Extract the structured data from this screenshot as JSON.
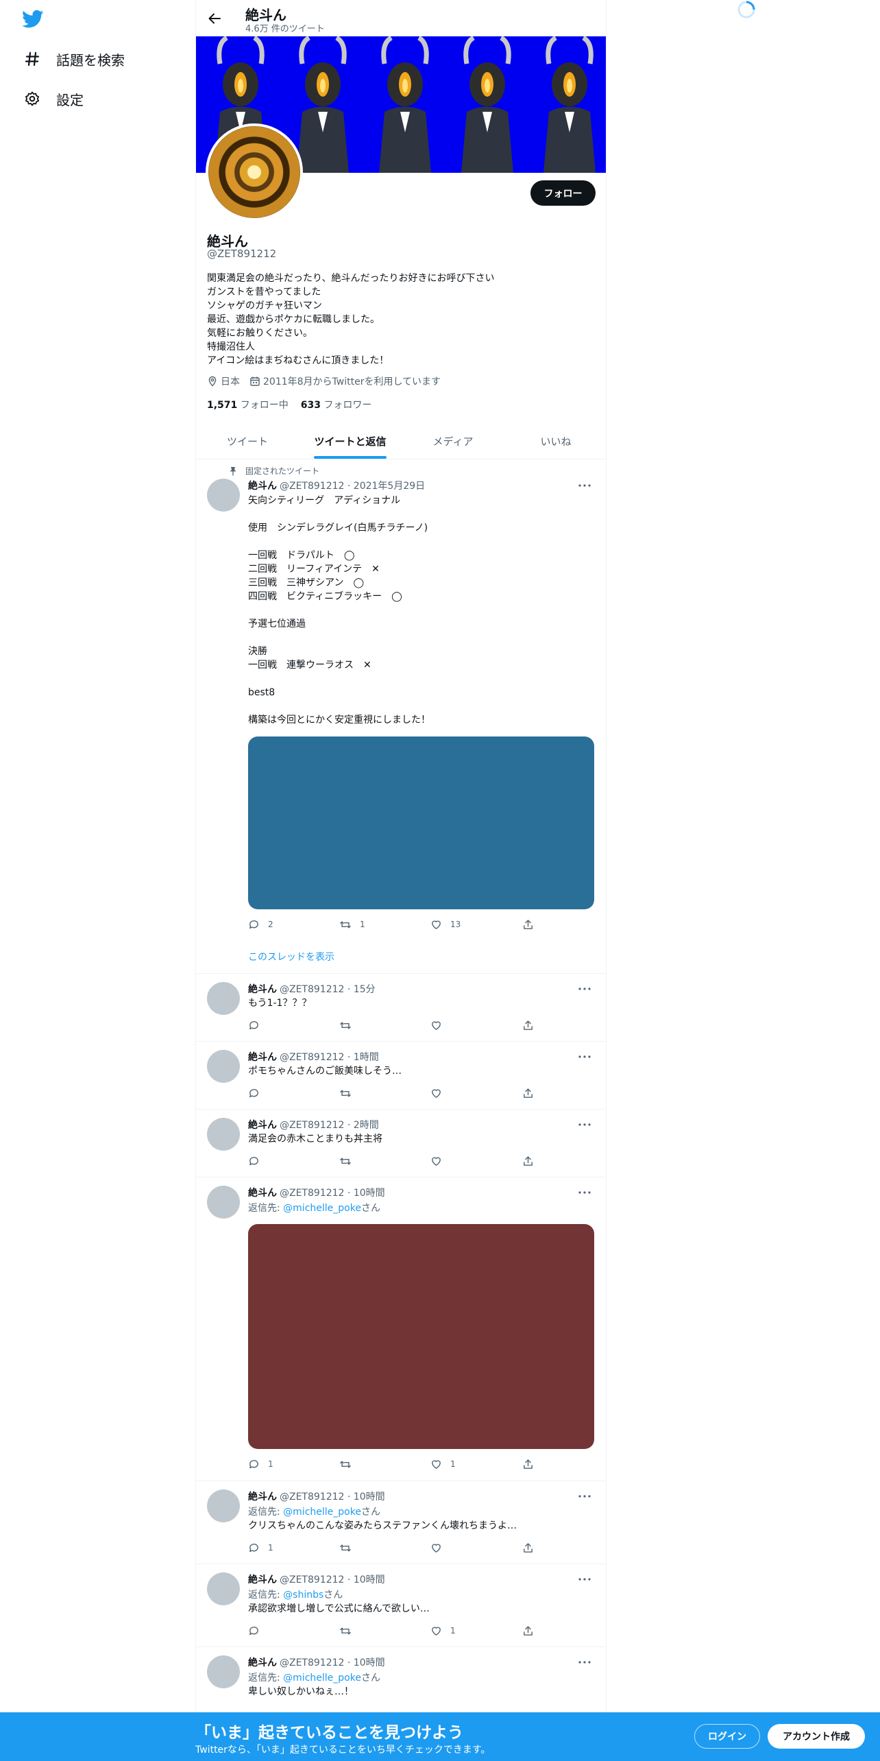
{
  "sidebar": {
    "logo_icon": "twitter-bird-icon",
    "items": [
      {
        "label": "話題を検索",
        "icon": "hashtag-icon"
      },
      {
        "label": "設定",
        "icon": "gear-icon"
      }
    ]
  },
  "header": {
    "title": "絶斗ん",
    "subtitle": "4.6万 件のツイート"
  },
  "profile": {
    "name": "絶斗ん",
    "handle": "@ZET891212",
    "follow_label": "フォロー",
    "bio": [
      "関東満足会の絶斗だったり、絶斗んだったりお好きにお呼び下さい",
      "ガンストを昔やってました",
      "ソシャゲのガチャ狂いマン",
      "最近、遊戯からポケカに転職しました。",
      "気軽にお触りください。",
      "特撮沼住人",
      "アイコン絵はまぢねむさんに頂きました！"
    ],
    "location": "日本",
    "joined": "2011年8月からTwitterを利用しています",
    "following_count": "1,571",
    "following_label": "フォロー中",
    "followers_count": "633",
    "followers_label": "フォロワー"
  },
  "tabs": [
    {
      "label": "ツイート",
      "active": false
    },
    {
      "label": "ツイートと返信",
      "active": true
    },
    {
      "label": "メディア",
      "active": false
    },
    {
      "label": "いいね",
      "active": false
    }
  ],
  "colors": {
    "accent": "#1d9bf0",
    "banner_bg": "#0000f0",
    "media_blue": "#2a6f97",
    "media_red": "#723435"
  },
  "tweets": [
    {
      "pinned_label": "固定されたツイート",
      "name": "絶斗ん",
      "meta": "@ZET891212 · 2021年5月29日",
      "lines": [
        "矢向シティリーグ　アディショナル",
        "",
        "使用　シンデレラグレイ(白馬チラチーノ)",
        "",
        "一回戦　ドラパルト　◯",
        "二回戦　リーフィアインテ　✕",
        "三回戦　三神ザシアン　◯",
        "四回戦　ビクティニブラッキー　◯",
        "",
        "予選七位通過",
        "",
        "決勝",
        "一回戦　連撃ウーラオス　✕",
        "",
        "best8",
        "",
        "構築は今回とにかく安定重視にしました！"
      ],
      "reply_count": "2",
      "retweet_count": "1",
      "like_count": "13",
      "thread_link": "このスレッドを表示"
    },
    {
      "name": "絶斗ん",
      "meta": "@ZET891212 · 15分",
      "text": "もう1-1？？？",
      "reply_count": "",
      "retweet_count": "",
      "like_count": ""
    },
    {
      "name": "絶斗ん",
      "meta": "@ZET891212 · 1時間",
      "text": "ポモちゃんさんのご飯美味しそう…",
      "reply_count": "",
      "retweet_count": "",
      "like_count": ""
    },
    {
      "name": "絶斗ん",
      "meta": "@ZET891212 · 2時間",
      "text": "満足会の赤木ことまりも丼主将",
      "reply_count": "",
      "retweet_count": "",
      "like_count": ""
    },
    {
      "name": "絶斗ん",
      "meta": "@ZET891212 · 10時間",
      "reply_prefix": "返信先: ",
      "reply_to": "@michelle_poke",
      "reply_suffix": "さん",
      "reply_count": "1",
      "retweet_count": "",
      "like_count": "1"
    },
    {
      "name": "絶斗ん",
      "meta": "@ZET891212 · 10時間",
      "reply_prefix": "返信先: ",
      "reply_to": "@michelle_poke",
      "reply_suffix": "さん",
      "text": "クリスちゃんのこんな姿みたらステファンくん壊れちまうよ…",
      "reply_count": "1",
      "retweet_count": "",
      "like_count": ""
    },
    {
      "name": "絶斗ん",
      "meta": "@ZET891212 · 10時間",
      "reply_prefix": "返信先: ",
      "reply_to": "@shinbs",
      "reply_suffix": "さん",
      "text": "承認欲求増し増しで公式に絡んで欲しい…",
      "reply_count": "",
      "retweet_count": "",
      "like_count": "1"
    },
    {
      "name": "絶斗ん",
      "meta": "@ZET891212 · 10時間",
      "reply_prefix": "返信先: ",
      "reply_to": "@michelle_poke",
      "reply_suffix": "さん",
      "text": "卑しい奴しかいねぇ…！"
    }
  ],
  "bottom_bar": {
    "title": "「いま」起きていることを見つけよう",
    "subtitle": "Twitterなら、「いま」起きていることをいち早くチェックできます。",
    "login_label": "ログイン",
    "signup_label": "アカウント作成"
  }
}
